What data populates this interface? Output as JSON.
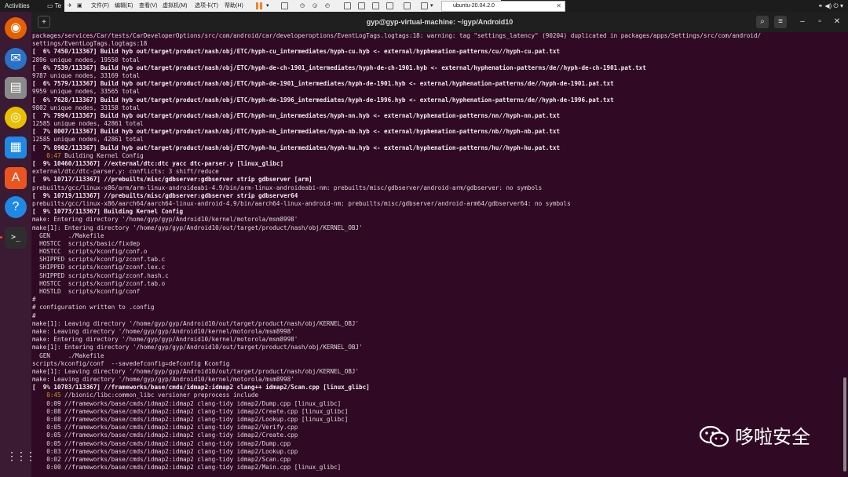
{
  "panel": {
    "activities": "Activities",
    "app_name_partial": "Te",
    "tray": "⚭ ◀) ⏻ ▾"
  },
  "vmware": {
    "menus": [
      "文件(F)",
      "编辑(E)",
      "查看(V)",
      "虚拟机(M)",
      "选项卡(T)",
      "帮助(H)"
    ],
    "tab_title": "ubuntu-20.04.2.0"
  },
  "dock": {
    "items": [
      {
        "name": "firefox-icon",
        "glyph": "◉",
        "color": "#e66000"
      },
      {
        "name": "thunderbird-icon",
        "glyph": "✉",
        "color": "#2a72c7"
      },
      {
        "name": "files-icon",
        "glyph": "▤",
        "color": "#8a8a8a"
      },
      {
        "name": "rhythmbox-icon",
        "glyph": "◎",
        "color": "#e8c000"
      },
      {
        "name": "writer-icon",
        "glyph": "▦",
        "color": "#1e88e5"
      },
      {
        "name": "software-icon",
        "glyph": "A",
        "color": "#e95420"
      },
      {
        "name": "help-icon",
        "glyph": "?",
        "color": "#1e88e5"
      },
      {
        "name": "terminal-icon",
        "glyph": ">_",
        "color": "#2e2e2e"
      }
    ],
    "apps_grid": "⋮⋮⋮"
  },
  "terminal": {
    "title": "gyp@gyp-virtual-machine: ~/gyp/Android10",
    "lines": [
      {
        "t": "packages/services/Car/tests/CarDeveloperOptions/src/com/android/car/developeroptions/EventLogTags.logtags:18: warning: tag \"settings_latency\" (90204) duplicated in packages/apps/Settings/src/com/android/",
        "b": false
      },
      {
        "t": "settings/EventLogTags.logtags:18",
        "b": false
      },
      {
        "t": "[  6% 7450/113367] Build hyb out/target/product/nash/obj/ETC/hyph-cu_intermediates/hyph-cu.hyb <- external/hyphenation-patterns/cu//hyph-cu.pat.txt",
        "b": true
      },
      {
        "t": "2896 unique nodes, 19550 total",
        "b": false
      },
      {
        "t": "[  6% 7539/113367] Build hyb out/target/product/nash/obj/ETC/hyph-de-ch-1901_intermediates/hyph-de-ch-1901.hyb <- external/hyphenation-patterns/de//hyph-de-ch-1901.pat.txt",
        "b": true
      },
      {
        "t": "9787 unique nodes, 33169 total",
        "b": false
      },
      {
        "t": "[  6% 7579/113367] Build hyb out/target/product/nash/obj/ETC/hyph-de-1901_intermediates/hyph-de-1901.hyb <- external/hyphenation-patterns/de//hyph-de-1901.pat.txt",
        "b": true
      },
      {
        "t": "9959 unique nodes, 33565 total",
        "b": false
      },
      {
        "t": "[  6% 7628/113367] Build hyb out/target/product/nash/obj/ETC/hyph-de-1996_intermediates/hyph-de-1996.hyb <- external/hyphenation-patterns/de//hyph-de-1996.pat.txt",
        "b": true
      },
      {
        "t": "9802 unique nodes, 33158 total",
        "b": false
      },
      {
        "t": "[  7% 7994/113367] Build hyb out/target/product/nash/obj/ETC/hyph-nn_intermediates/hyph-nn.hyb <- external/hyphenation-patterns/nn//hyph-nn.pat.txt",
        "b": true
      },
      {
        "t": "12585 unique nodes, 42861 total",
        "b": false
      },
      {
        "t": "[  7% 8007/113367] Build hyb out/target/product/nash/obj/ETC/hyph-nb_intermediates/hyph-nb.hyb <- external/hyphenation-patterns/nb//hyph-nb.pat.txt",
        "b": true
      },
      {
        "t": "12585 unique nodes, 42861 total",
        "b": false
      },
      {
        "t": "[  7% 8902/113367] Build hyb out/target/product/nash/obj/ETC/hyph-hu_intermediates/hyph-hu.hyb <- external/hyphenation-patterns/hu//hyph-hu.pat.txt",
        "b": true
      },
      {
        "t": "    0:47 Building Kernel Config",
        "b": false,
        "y": "0:47"
      },
      {
        "t": "[  9% 10460/113367] //external/dtc:dtc yacc dtc-parser.y [linux_glibc]",
        "b": true
      },
      {
        "t": "external/dtc/dtc-parser.y: conflicts: 3 shift/reduce",
        "b": false
      },
      {
        "t": "[  9% 10717/113367] //prebuilts/misc/gdbserver:gdbserver strip gdbserver [arm]",
        "b": true
      },
      {
        "t": "prebuilts/gcc/linux-x86/arm/arm-linux-androideabi-4.9/bin/arm-linux-androideabi-nm: prebuilts/misc/gdbserver/android-arm/gdbserver: no symbols",
        "b": false
      },
      {
        "t": "[  9% 10719/113367] //prebuilts/misc/gdbserver:gdbserver strip gdbserver64",
        "b": true
      },
      {
        "t": "prebuilts/gcc/linux-x86/aarch64/aarch64-linux-android-4.9/bin/aarch64-linux-android-nm: prebuilts/misc/gdbserver/android-arm64/gdbserver64: no symbols",
        "b": false
      },
      {
        "t": "[  9% 10773/113367] Building Kernel Config",
        "b": true
      },
      {
        "t": "make: Entering directory '/home/gyp/gyp/Android10/kernel/motorola/msm8998'",
        "b": false
      },
      {
        "t": "make[1]: Entering directory '/home/gyp/gyp/Android10/out/target/product/nash/obj/KERNEL_OBJ'",
        "b": false
      },
      {
        "t": "  GEN     ./Makefile",
        "b": false
      },
      {
        "t": "  HOSTCC  scripts/basic/fixdep",
        "b": false
      },
      {
        "t": "  HOSTCC  scripts/kconfig/conf.o",
        "b": false
      },
      {
        "t": "  SHIPPED scripts/kconfig/zconf.tab.c",
        "b": false
      },
      {
        "t": "  SHIPPED scripts/kconfig/zconf.lex.c",
        "b": false
      },
      {
        "t": "  SHIPPED scripts/kconfig/zconf.hash.c",
        "b": false
      },
      {
        "t": "  HOSTCC  scripts/kconfig/zconf.tab.o",
        "b": false
      },
      {
        "t": "  HOSTLD  scripts/kconfig/conf",
        "b": false
      },
      {
        "t": "#",
        "b": false
      },
      {
        "t": "# configuration written to .config",
        "b": false
      },
      {
        "t": "#",
        "b": false
      },
      {
        "t": "make[1]: Leaving directory '/home/gyp/gyp/Android10/out/target/product/nash/obj/KERNEL_OBJ'",
        "b": false
      },
      {
        "t": "make: Leaving directory '/home/gyp/gyp/Android10/kernel/motorola/msm8998'",
        "b": false
      },
      {
        "t": "make: Entering directory '/home/gyp/gyp/Android10/kernel/motorola/msm8998'",
        "b": false
      },
      {
        "t": "make[1]: Entering directory '/home/gyp/gyp/Android10/out/target/product/nash/obj/KERNEL_OBJ'",
        "b": false
      },
      {
        "t": "  GEN     ./Makefile",
        "b": false
      },
      {
        "t": "scripts/kconfig/conf  --savedefconfig=defconfig Kconfig",
        "b": false
      },
      {
        "t": "make[1]: Leaving directory '/home/gyp/gyp/Android10/out/target/product/nash/obj/KERNEL_OBJ'",
        "b": false
      },
      {
        "t": "make: Leaving directory '/home/gyp/gyp/Android10/kernel/motorola/msm8998'",
        "b": false
      },
      {
        "t": "[  9% 10783/113367] //frameworks/base/cmds/idmap2:idmap2 clang++ idmap2/Scan.cpp [linux_glibc]",
        "b": true
      },
      {
        "t": "    0:45 //bionic/libc:common_libc versioner preprocess include",
        "b": false,
        "y": "0:45"
      },
      {
        "t": "    0:09 //frameworks/base/cmds/idmap2:idmap2 clang-tidy idmap2/Dump.cpp [linux_glibc]",
        "b": false
      },
      {
        "t": "    0:08 //frameworks/base/cmds/idmap2:idmap2 clang-tidy idmap2/Create.cpp [linux_glibc]",
        "b": false
      },
      {
        "t": "    0:08 //frameworks/base/cmds/idmap2:idmap2 clang-tidy idmap2/Lookup.cpp [linux_glibc]",
        "b": false
      },
      {
        "t": "    0:05 //frameworks/base/cmds/idmap2:idmap2 clang-tidy idmap2/Verify.cpp",
        "b": false
      },
      {
        "t": "    0:05 //frameworks/base/cmds/idmap2:idmap2 clang-tidy idmap2/Create.cpp",
        "b": false
      },
      {
        "t": "    0:05 //frameworks/base/cmds/idmap2:idmap2 clang-tidy idmap2/Dump.cpp",
        "b": false
      },
      {
        "t": "    0:03 //frameworks/base/cmds/idmap2:idmap2 clang-tidy idmap2/Lookup.cpp",
        "b": false
      },
      {
        "t": "    0:02 //frameworks/base/cmds/idmap2:idmap2 clang-tidy idmap2/Scan.cpp",
        "b": false
      },
      {
        "t": "    0:00 //frameworks/base/cmds/idmap2:idmap2 clang-tidy idmap2/Main.cpp [linux_glibc]",
        "b": false
      }
    ]
  },
  "watermark": {
    "text": "哆啦安全"
  },
  "colors": {
    "terminal_bg": "#300a24",
    "accent": "#e95420",
    "highlight": "#c4a000"
  }
}
